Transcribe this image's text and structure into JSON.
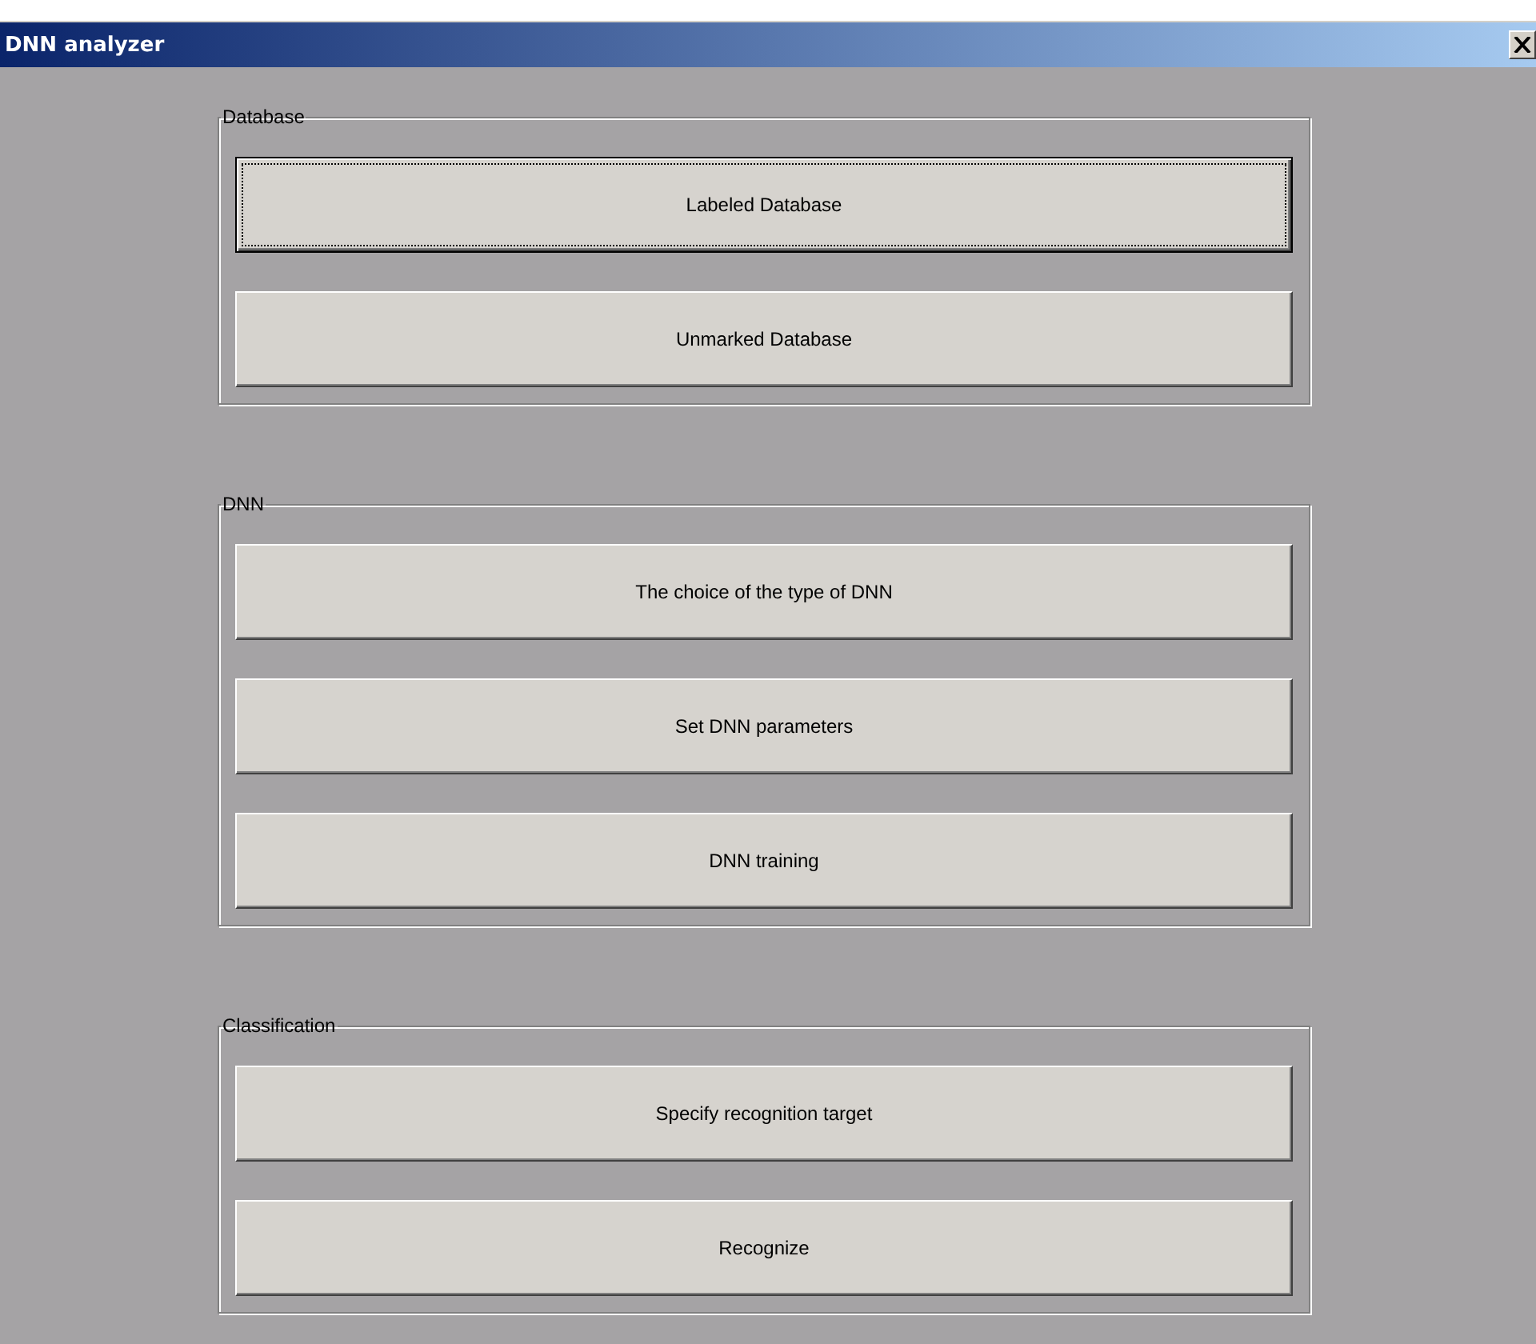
{
  "window": {
    "title": "DNN analyzer"
  },
  "groups": [
    {
      "label": "Database",
      "buttons": [
        {
          "label": "Labeled Database",
          "focused": true
        },
        {
          "label": "Unmarked Database",
          "focused": false
        }
      ]
    },
    {
      "label": "DNN",
      "buttons": [
        {
          "label": "The choice of the type of DNN",
          "focused": false
        },
        {
          "label": "Set DNN parameters",
          "focused": false
        },
        {
          "label": "DNN training",
          "focused": false
        }
      ]
    },
    {
      "label": "Classification",
      "buttons": [
        {
          "label": "Specify recognition target",
          "focused": false
        },
        {
          "label": "Recognize",
          "focused": false
        }
      ]
    }
  ]
}
